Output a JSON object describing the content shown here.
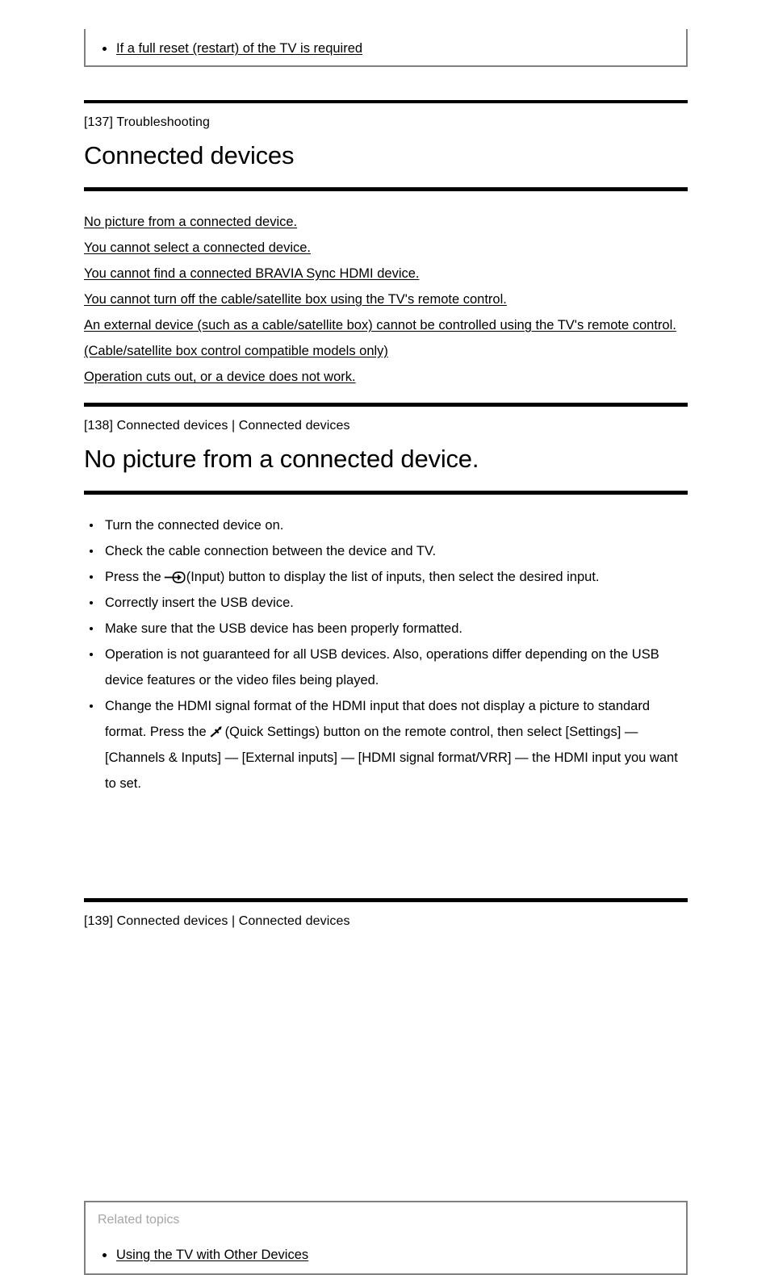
{
  "top_box": {
    "items": [
      {
        "label": "If a full reset (restart) of the TV is required"
      }
    ]
  },
  "section_137": {
    "breadcrumb": "[137] Troubleshooting",
    "title": "Connected devices",
    "links": [
      {
        "label": "No picture from a connected device."
      },
      {
        "label": "You cannot select a connected device."
      },
      {
        "label": "You cannot find a connected BRAVIA Sync HDMI device."
      },
      {
        "label": "You cannot turn off the cable/satellite box using the TV's remote control."
      },
      {
        "label": "An external device (such as a cable/satellite box) cannot be controlled using the TV's remote control. (Cable/satellite box control compatible models only)"
      },
      {
        "label": "Operation cuts out, or a device does not work."
      }
    ]
  },
  "section_138": {
    "breadcrumb": "[138] Connected devices | Connected devices",
    "title": "No picture from a connected device.",
    "steps": {
      "s1": "Turn the connected device on.",
      "s2": "Check the cable connection between the device and TV.",
      "s3_before": "Press the",
      "s3_icon": "input-icon",
      "s3_after": "(Input) button to display the list of inputs, then select the desired input.",
      "s4": "Correctly insert the USB device.",
      "s5": "Make sure that the USB device has been properly formatted.",
      "s6": "Operation is not guaranteed for all USB devices. Also, operations differ depending on the USB device features or the video files being played.",
      "s7_before": "Change the HDMI signal format of the HDMI input that does not display a picture to standard format. Press the",
      "s7_icon": "wrench-icon",
      "s7_after": "(Quick Settings) button on the remote control, then select [Settings] — [Channels & Inputs] — [External inputs] — [HDMI signal format/VRR] — the HDMI input you want to set."
    },
    "related": {
      "heading": "Related topics",
      "links": [
        {
          "label": "Using the TV with Other Devices"
        }
      ]
    }
  },
  "section_139": {
    "breadcrumb": "[139] Connected devices | Connected devices"
  },
  "colors": {
    "rule": "#000000",
    "box_border": "#808080",
    "related_heading": "#a6a6a6",
    "text": "#000000"
  }
}
